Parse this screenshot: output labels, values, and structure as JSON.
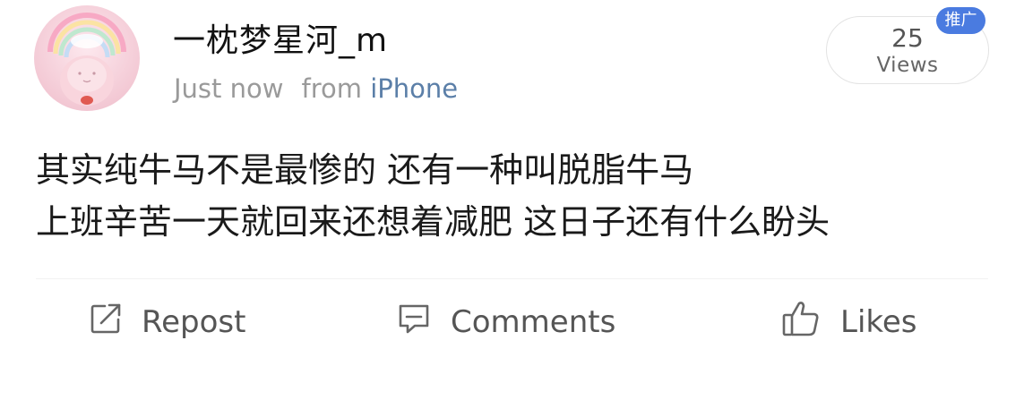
{
  "post": {
    "author": {
      "name": "一枕梦星河_m"
    },
    "meta": {
      "time": "Just now",
      "from_label": "from",
      "source": "iPhone"
    },
    "views": {
      "count": "25",
      "label": "Views"
    },
    "badge": "推广",
    "content_lines": [
      "其实纯牛马不是最惨的 还有一种叫脱脂牛马",
      "上班辛苦一天就回来还想着减肥 这日子还有什么盼头"
    ]
  },
  "actions": {
    "repost": {
      "label": "Repost",
      "icon": "repost-icon"
    },
    "comments": {
      "label": "Comments",
      "icon": "comment-icon"
    },
    "likes": {
      "label": "Likes",
      "icon": "thumbs-up-icon"
    }
  },
  "colors": {
    "link": "#5b7fa8",
    "badge": "#4a7be0",
    "meta_text": "#9a9a9a"
  }
}
